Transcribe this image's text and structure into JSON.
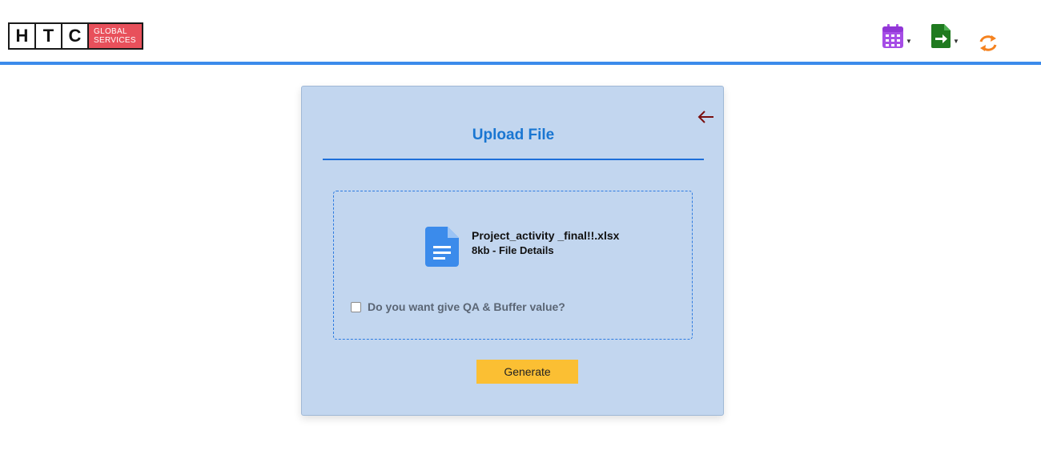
{
  "header": {
    "logo": {
      "letters": [
        "H",
        "T",
        "C"
      ],
      "brand_line1": "GLOBAL",
      "brand_line2": "SERVICES"
    },
    "actions": [
      {
        "icon": "calendar-icon",
        "color": "#a64de6",
        "has_dropdown": true
      },
      {
        "icon": "file-export-icon",
        "color": "#1f7a1f",
        "has_dropdown": true
      },
      {
        "icon": "refresh-icon",
        "color": "#f5821f",
        "has_dropdown": false
      }
    ],
    "accent_color": "#3b8beb"
  },
  "upload": {
    "title": "Upload File",
    "back_icon": "arrow-left-icon",
    "file": {
      "icon": "document-icon",
      "name": "Project_activity _final!!.xlsx",
      "meta": "8kb -  File Details"
    },
    "qa_option": {
      "label": "Do you want give QA & Buffer value?",
      "checked": false
    },
    "generate_label": "Generate",
    "card_color": "#c2d6ef",
    "button_color": "#fbbf33"
  }
}
